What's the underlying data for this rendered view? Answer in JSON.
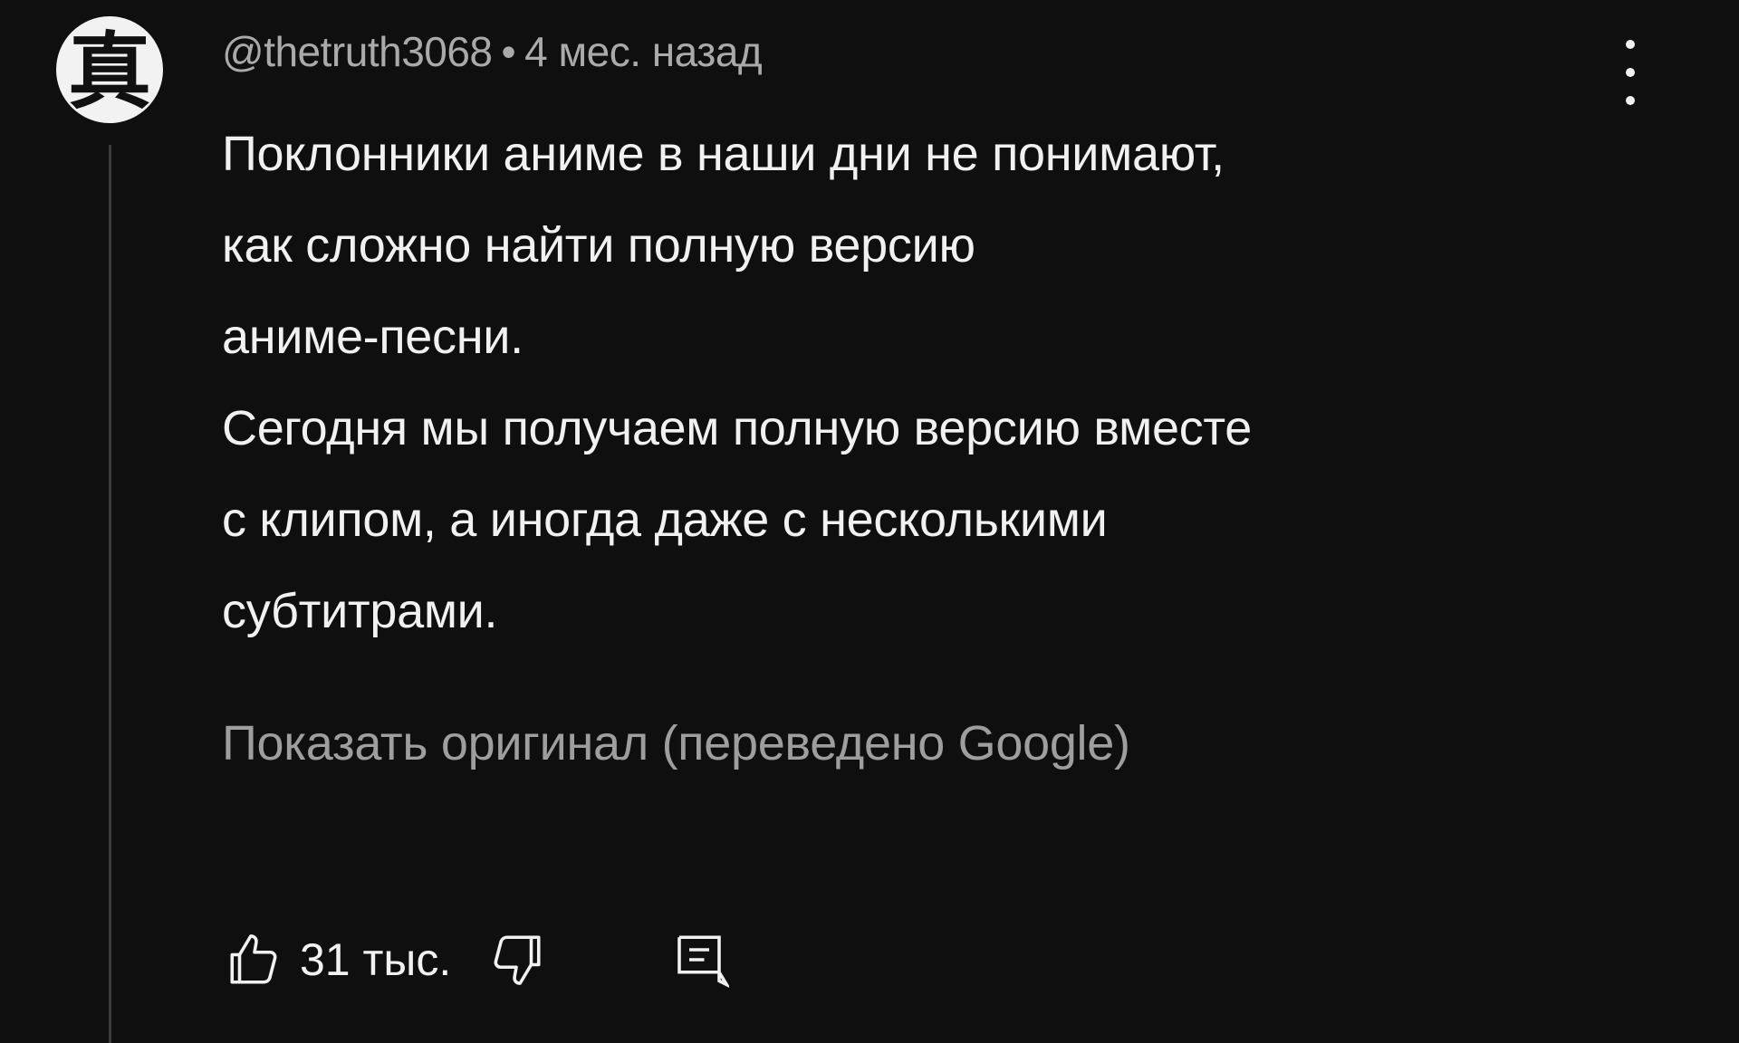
{
  "comment": {
    "avatar_glyph": "真",
    "author": "@thetruth3068",
    "separator": "•",
    "timestamp": "4 мес. назад",
    "paragraphs": [
      "Поклонники аниме в наши дни не понимают,\nкак сложно найти полную версию\nаниме-песни.",
      "Сегодня мы получаем полную версию вместе\nс клипом, а иногда даже с несколькими\nсубтитрами."
    ],
    "translate_link": "Показать оригинал (переведено Google)",
    "like_count": "31 тыс."
  },
  "icons": {
    "menu": "more-vertical-icon",
    "like": "thumbs-up-icon",
    "dislike": "thumbs-down-icon",
    "reply": "comment-reply-icon"
  },
  "colors": {
    "background": "#0f0f0f",
    "text": "#f1f1f1",
    "secondary_text": "#aaaaaa"
  }
}
